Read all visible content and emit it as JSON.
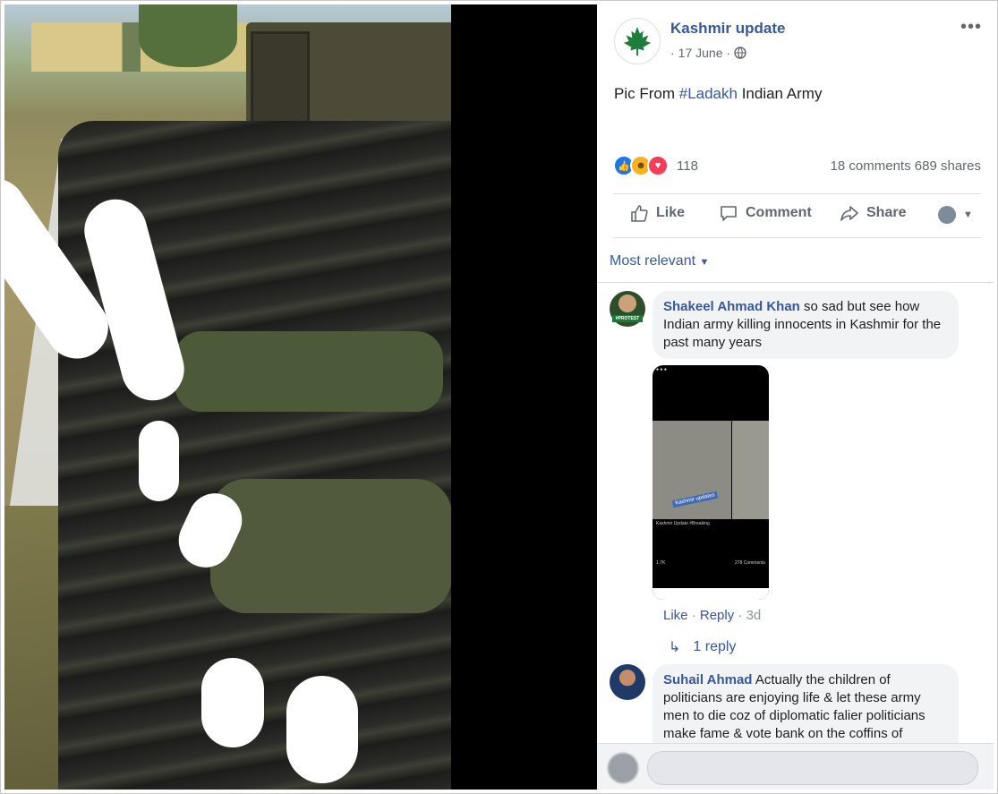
{
  "post": {
    "page_name": "Kashmir update",
    "date": "17 June",
    "text_prefix": "Pic From ",
    "hashtag": "#Ladakh",
    "text_suffix": " Indian Army",
    "reaction_count": "118",
    "comments_count": "18 comments",
    "shares_count": "689 shares",
    "more_label": "•••"
  },
  "actions": {
    "like": "Like",
    "comment": "Comment",
    "share": "Share"
  },
  "sort": {
    "label": "Most relevant"
  },
  "comments": [
    {
      "author": "Shakeel Ahmad Khan",
      "text": "so sad but see how Indian army killing innocents in Kashmir for the past many years",
      "like": "Like",
      "reply": "Reply",
      "time": "3d",
      "replies": "1 reply"
    },
    {
      "author": "Suhail Ahmad",
      "text": "Actually the children of politicians are enjoying life & let these army men to die coz of diplomatic falier politicians make fame & vote bank on the coffins of"
    }
  ],
  "phone_screenshot": {
    "label": "Kashmir updates",
    "caption": "Kashmir Update #Breaking",
    "count": "1.7K",
    "comments": "278 Comments"
  },
  "avatar_badge": "#PROTEST",
  "colors": {
    "link": "#385898",
    "muted": "#606770",
    "bubble": "#f2f3f5"
  }
}
